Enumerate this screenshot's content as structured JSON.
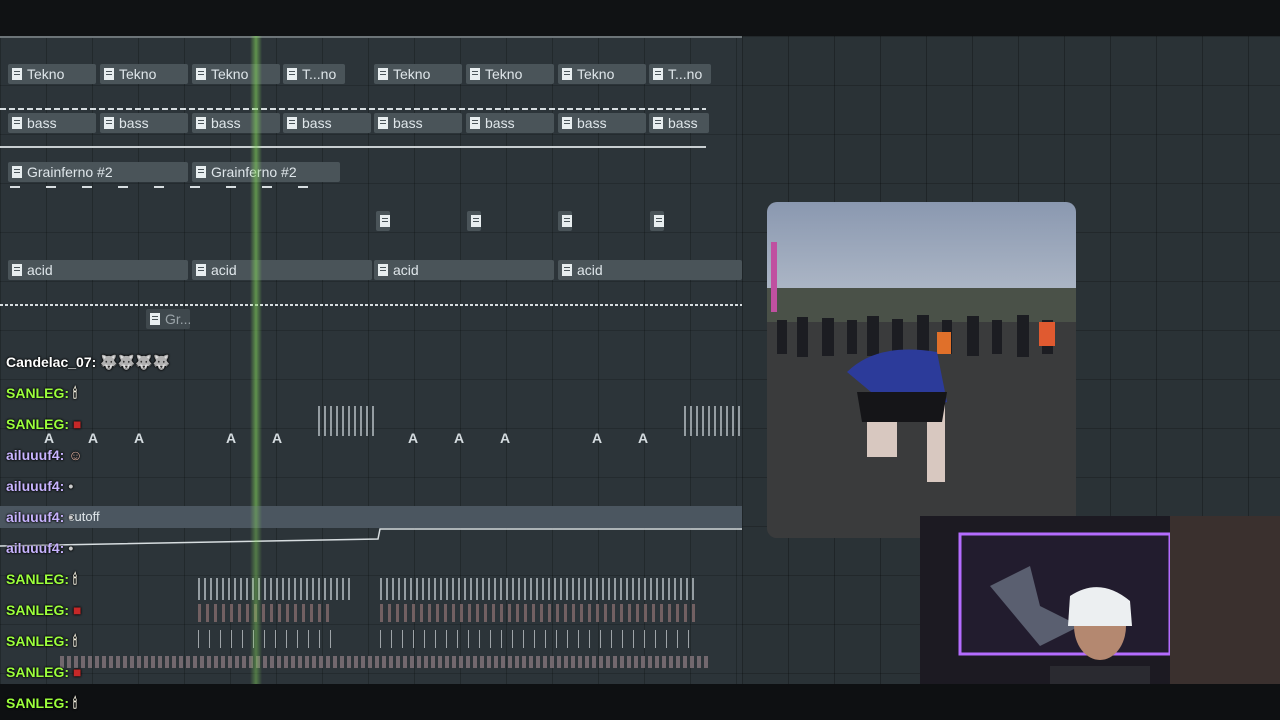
{
  "playlist": {
    "row1": [
      "Tekno",
      "Tekno",
      "Tekno",
      "T...no",
      "Tekno",
      "Tekno",
      "Tekno",
      "T...no"
    ],
    "row2": [
      "bass",
      "bass",
      "bass",
      "bass",
      "bass",
      "bass",
      "bass",
      "bass"
    ],
    "row3": [
      "Grainferno #2",
      "Grainferno #2"
    ],
    "row5": [
      "acid",
      "acid",
      "acid",
      "acid"
    ],
    "row6": [
      "Gr..."
    ],
    "automation_label": "cutoff"
  },
  "chat": [
    {
      "user": "Candelac_07:",
      "color": "#ffffff",
      "emote": "wolf-icons"
    },
    {
      "user": "SANLEG:",
      "color": "#9cff3c",
      "emote": "candle-icon"
    },
    {
      "user": "SANLEG:",
      "color": "#9cff3c",
      "emote": "red-icon"
    },
    {
      "user": "ailuuuf4:",
      "color": "#c8b4ff",
      "emote": "face-icon"
    },
    {
      "user": "ailuuuf4:",
      "color": "#c8b4ff",
      "emote": "small-icon"
    },
    {
      "user": "ailuuuf4:",
      "color": "#c8b4ff",
      "emote": "small-icon"
    },
    {
      "user": "ailuuuf4:",
      "color": "#c8b4ff",
      "emote": "small-icon"
    },
    {
      "user": "SANLEG:",
      "color": "#9cff3c",
      "emote": "candle-icon"
    },
    {
      "user": "SANLEG:",
      "color": "#9cff3c",
      "emote": "red-icon"
    },
    {
      "user": "SANLEG:",
      "color": "#9cff3c",
      "emote": "candle-icon"
    },
    {
      "user": "SANLEG:",
      "color": "#9cff3c",
      "emote": "red-icon"
    },
    {
      "user": "SANLEG:",
      "color": "#9cff3c",
      "emote": "candle-icon"
    }
  ],
  "colors": {
    "playhead": "#8fd05a",
    "sanleg": "#9cff3c",
    "ailuuuf4": "#c8b4ff",
    "webcam_light": "#b46cff"
  }
}
